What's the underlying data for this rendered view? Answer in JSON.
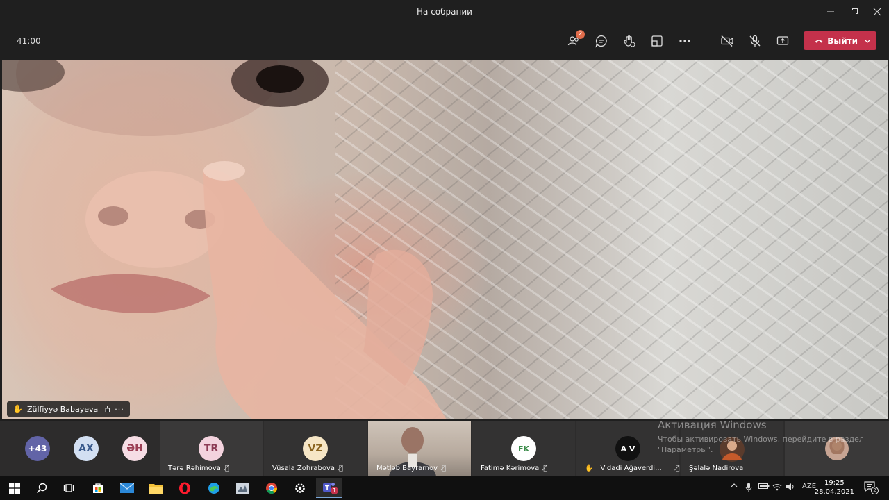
{
  "window": {
    "title": "На собрании"
  },
  "toolbar": {
    "timer": "41:00",
    "participants_badge": "2",
    "leave_label": "Выйти"
  },
  "stage": {
    "speaker_name": "Zülfiyyə Babayeva"
  },
  "participants": {
    "overflow": "+43",
    "avatars": [
      {
        "initials": "AX",
        "bg": "#d2dff2",
        "fg": "#3a5a8c"
      },
      {
        "initials": "ƏH",
        "bg": "#f6dde5",
        "fg": "#9c3f55"
      }
    ],
    "tiles": [
      {
        "initials": "TR",
        "name": "Tərə Rəhimova",
        "bg": "#f3d3de",
        "fg": "#8c3b55"
      },
      {
        "initials": "VZ",
        "name": "Vüsala Zohrabova",
        "bg": "#f6e6c6",
        "fg": "#8a6420"
      },
      {
        "initials": "",
        "name": "Mətləb Bayramov"
      },
      {
        "initials": "FK",
        "name": "Fatimə Kərimova",
        "bg": "#ffffff",
        "fg": "#3b8c4a"
      },
      {
        "initials": "A V",
        "name": "Vidadi Ağaverdi...",
        "bg": "#111111",
        "fg": "#ffffff"
      },
      {
        "initials": "",
        "name": "Şəlalə Nadirova"
      }
    ]
  },
  "watermark": {
    "title": "Активация Windows",
    "line1": "Чтобы активировать Windows, перейдите в раздел",
    "line2": "\"Параметры\"."
  },
  "taskbar": {
    "language": "AZE",
    "time": "19:25",
    "date": "28.04.2021",
    "notif_count": "2",
    "teams_badge": "1"
  },
  "colors": {
    "leave": "#c4314b",
    "overflow_avatar": "#6264a7",
    "badge": "#e06c4b"
  }
}
